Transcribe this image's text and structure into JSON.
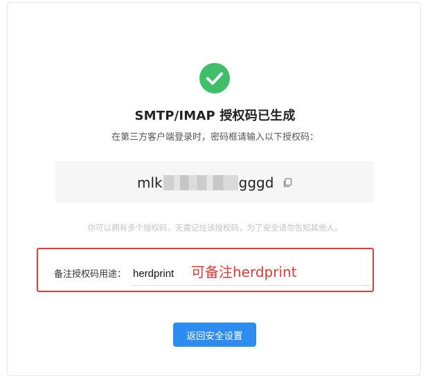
{
  "status": {
    "icon": "check-circle-icon",
    "color": "#3fbf6a"
  },
  "title": "SMTP/IMAP 授权码已生成",
  "subtitle": "在第三方客户端登录时，密码框请输入以下授权码：",
  "auth_code": {
    "prefix": "mlk",
    "suffix": "gggd",
    "masked": true,
    "copy_icon": "copy-icon"
  },
  "hint": "你可以拥有多个授权码，无需记住该授权码，为了安全请勿告知其他人。",
  "remark": {
    "label": "备注授权码用途：",
    "value": "herdprint",
    "placeholder": ""
  },
  "annotation": {
    "text": "可备注herdprint",
    "color": "#e53935"
  },
  "back_button": {
    "label": "返回安全设置",
    "color": "#2d8cf0"
  }
}
